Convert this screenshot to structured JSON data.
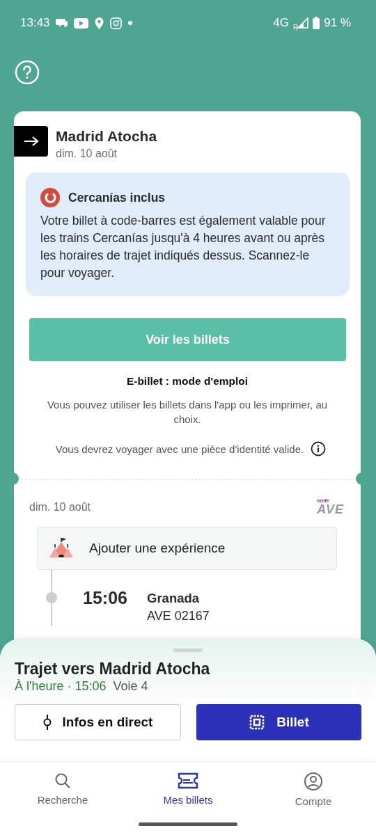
{
  "status_bar": {
    "time": "13:43",
    "network": "4G",
    "roaming": "R",
    "battery": "91 %"
  },
  "trip": {
    "destination": "Madrid Atocha",
    "date": "dim. 10 août"
  },
  "notice": {
    "title": "Cercanías inclus",
    "body": "Votre billet à code-barres est également valable pour les trains Cercanías jusqu'à 4 heures avant ou après les horaires de trajet indiqués dessus. Scannez-le pour voyager."
  },
  "primary_button": "Voir les billets",
  "instructions": {
    "title": "E-billet : mode d'emploi",
    "text": "Vous pouvez utiliser les billets dans l'app ou les imprimer, au choix.",
    "id_note": "Vous devrez voyager avec une pièce d'identité valide."
  },
  "segment": {
    "date": "dim. 10 août",
    "operator_logo": {
      "brand": "renfe",
      "name": "AVE"
    },
    "experience": "Ajouter une expérience",
    "stops": [
      {
        "time": "15:06",
        "station": "Granada",
        "train": "AVE 02167"
      }
    ]
  },
  "sheet": {
    "title": "Trajet vers Madrid Atocha",
    "status": "À l'heure · 15:06",
    "platform": "Voie 4",
    "buttons": [
      {
        "kind": "outline",
        "label": "Infos en direct"
      },
      {
        "kind": "filled",
        "label": "Billet"
      }
    ]
  },
  "nav": [
    {
      "kind": "search",
      "label": "Recherche",
      "selected": false
    },
    {
      "kind": "ticket",
      "label": "Mes billets",
      "selected": true
    },
    {
      "kind": "account",
      "label": "Compte",
      "selected": false
    }
  ]
}
